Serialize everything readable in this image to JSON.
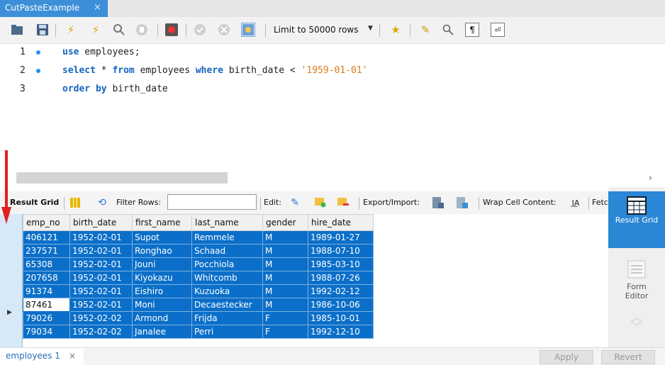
{
  "window": {
    "tab_title": "CutPasteExample",
    "tab_close": "×"
  },
  "toolbar": {
    "limit_label": "Limit to 50000 rows",
    "icons": [
      "folder-icon",
      "save-icon",
      "execute-icon",
      "execute-line-icon",
      "explain-icon",
      "stop-icon",
      "toggle-autocommit-icon",
      "commit-icon",
      "rollback-icon",
      "toggle-error-icon",
      "add-snippet-icon",
      "beautify-icon",
      "find-icon",
      "invisibles-icon",
      "wrap-icon"
    ]
  },
  "editor": {
    "lines": [
      {
        "num": "1",
        "tokens": [
          {
            "t": "kw",
            "v": "use"
          },
          {
            "t": "plain",
            "v": " employees;"
          }
        ]
      },
      {
        "num": "2",
        "tokens": [
          {
            "t": "kw",
            "v": "select"
          },
          {
            "t": "plain",
            "v": " * "
          },
          {
            "t": "kw",
            "v": "from"
          },
          {
            "t": "plain",
            "v": " employees "
          },
          {
            "t": "kw",
            "v": "where"
          },
          {
            "t": "plain",
            "v": " birth_date < "
          },
          {
            "t": "str",
            "v": "'1959-01-01'"
          }
        ]
      },
      {
        "num": "3",
        "tokens": [
          {
            "t": "kw",
            "v": "order by"
          },
          {
            "t": "plain",
            "v": " birth_date"
          }
        ]
      }
    ]
  },
  "result_toolbar": {
    "result_grid": "Result Grid",
    "filter_rows": "Filter Rows:",
    "edit": "Edit:",
    "export_import": "Export/Import:",
    "wrap_cell": "Wrap Cell Content:",
    "fetch": "Fetc"
  },
  "grid": {
    "columns": [
      "emp_no",
      "birth_date",
      "first_name",
      "last_name",
      "gender",
      "hire_date"
    ],
    "rows": [
      [
        "406121",
        "1952-02-01",
        "Supot",
        "Remmele",
        "M",
        "1989-01-27"
      ],
      [
        "237571",
        "1952-02-01",
        "Ronghao",
        "Schaad",
        "M",
        "1988-07-10"
      ],
      [
        "65308",
        "1952-02-01",
        "Jouni",
        "Pocchiola",
        "M",
        "1985-03-10"
      ],
      [
        "207658",
        "1952-02-01",
        "Kiyokazu",
        "Whitcomb",
        "M",
        "1988-07-26"
      ],
      [
        "91374",
        "1952-02-01",
        "Eishiro",
        "Kuzuoka",
        "M",
        "1992-02-12"
      ],
      [
        "87461",
        "1952-02-01",
        "Moni",
        "Decaestecker",
        "M",
        "1986-10-06"
      ],
      [
        "79026",
        "1952-02-02",
        "Armond",
        "Frijda",
        "F",
        "1985-10-01"
      ],
      [
        "79034",
        "1952-02-02",
        "Janalee",
        "Perri",
        "F",
        "1992-12-10"
      ]
    ],
    "current_row": 5
  },
  "side_panel": {
    "result_grid_label": "Result Grid",
    "form_editor_label": "Form Editor"
  },
  "bottom": {
    "tab_label": "employees 1",
    "tab_close": "×",
    "apply": "Apply",
    "revert": "Revert"
  },
  "colors": {
    "accent": "#3c8fd8",
    "selection": "#0b6fc9",
    "annotation": "#e02020"
  }
}
